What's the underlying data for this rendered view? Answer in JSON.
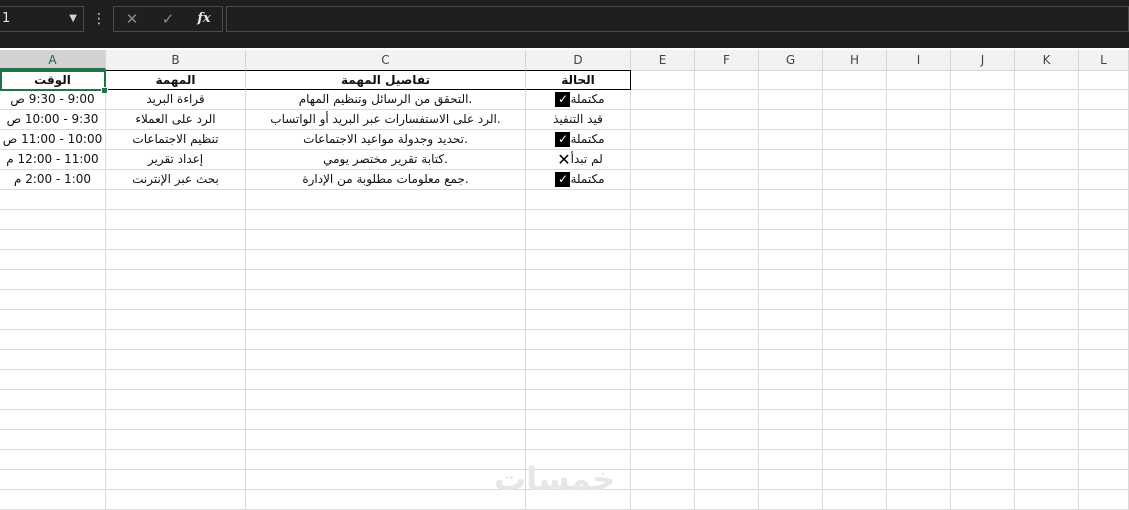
{
  "formula_bar": {
    "name_box": "1",
    "cancel_icon": "✕",
    "enter_icon": "✓",
    "fx_icon": "fx"
  },
  "columns": [
    "A",
    "B",
    "C",
    "D",
    "E",
    "F",
    "G",
    "H",
    "I",
    "J",
    "K",
    "L"
  ],
  "table": {
    "headers": {
      "a": "الوقت",
      "b": "المهمة",
      "c": "تفاصيل المهمة",
      "d": "الحالة"
    },
    "rows": [
      {
        "time": "9:00 - 9:30 ص",
        "task": "قراءة البريد",
        "details": "التحقق من الرسائل وتنظيم المهام.",
        "status": "مكتملة",
        "mark": "check"
      },
      {
        "time": "9:30 - 10:00 ص",
        "task": "الرد على العملاء",
        "details": "الرد على الاستفسارات عبر البريد أو الواتساب.",
        "status": "قيد التنفيذ",
        "mark": "none"
      },
      {
        "time": "10:00 - 11:00 ص",
        "task": "تنظيم الاجتماعات",
        "details": "تحديد وجدولة مواعيد الاجتماعات.",
        "status": "مكتملة",
        "mark": "check"
      },
      {
        "time": "11:00 - 12:00 م",
        "task": "إعداد تقرير",
        "details": "كتابة تقرير مختصر يومي.",
        "status": "لم تبدأ",
        "mark": "x"
      },
      {
        "time": "1:00 - 2:00 م",
        "task": "بحث عبر الإنترنت",
        "details": "جمع معلومات مطلوبة من الإدارة.",
        "status": "مكتملة",
        "mark": "check"
      }
    ]
  },
  "watermark": "خمسات"
}
